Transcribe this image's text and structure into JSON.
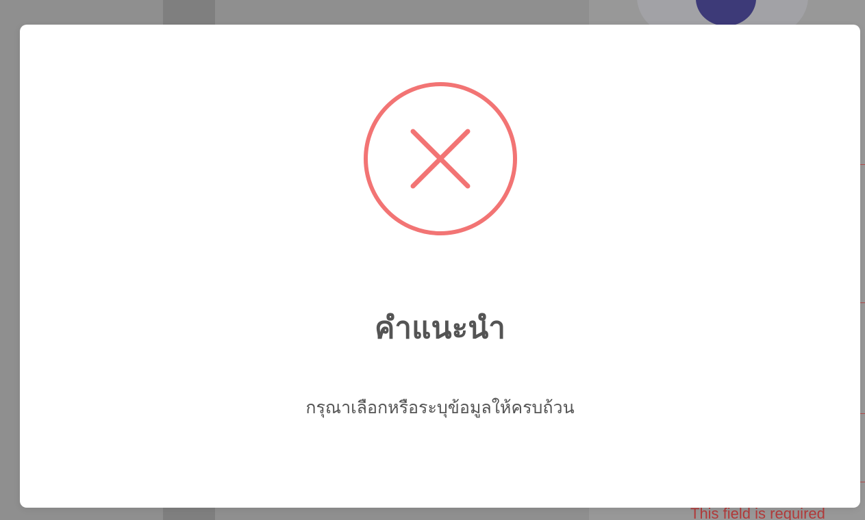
{
  "background": {
    "required_text": "This field is required"
  },
  "dialog": {
    "icon": "error-x-circle-icon",
    "icon_color": "#f27474",
    "title": "คำแนะนำ",
    "message": "กรุณาเลือกหรือระบุข้อมูลให้ครบถ้วน"
  }
}
